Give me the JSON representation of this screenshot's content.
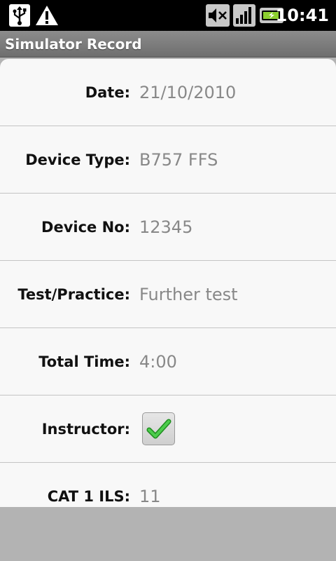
{
  "status_bar": {
    "time": "10:41",
    "icons": [
      "usb-icon",
      "warning-icon",
      "mute-icon",
      "signal-icon",
      "battery-charging-icon"
    ]
  },
  "app": {
    "title": "Simulator Record"
  },
  "form": {
    "rows": [
      {
        "label": "Date:",
        "value": "21/10/2010"
      },
      {
        "label": "Device Type:",
        "value": "B757 FFS"
      },
      {
        "label": "Device No:",
        "value": "12345"
      },
      {
        "label": "Test/Practice:",
        "value": "Further test"
      },
      {
        "label": "Total Time:",
        "value": "4:00"
      },
      {
        "label": "Instructor:",
        "checked": true
      },
      {
        "label": "CAT 1 ILS:",
        "value": "11"
      }
    ]
  },
  "colors": {
    "status_bar_bg": "#000000",
    "title_bar_bg": "#7d7d7d",
    "content_bg": "#f8f8f8",
    "value_text": "#888888",
    "check_green": "#3bb33b",
    "battery_green": "#8ccf2f"
  }
}
